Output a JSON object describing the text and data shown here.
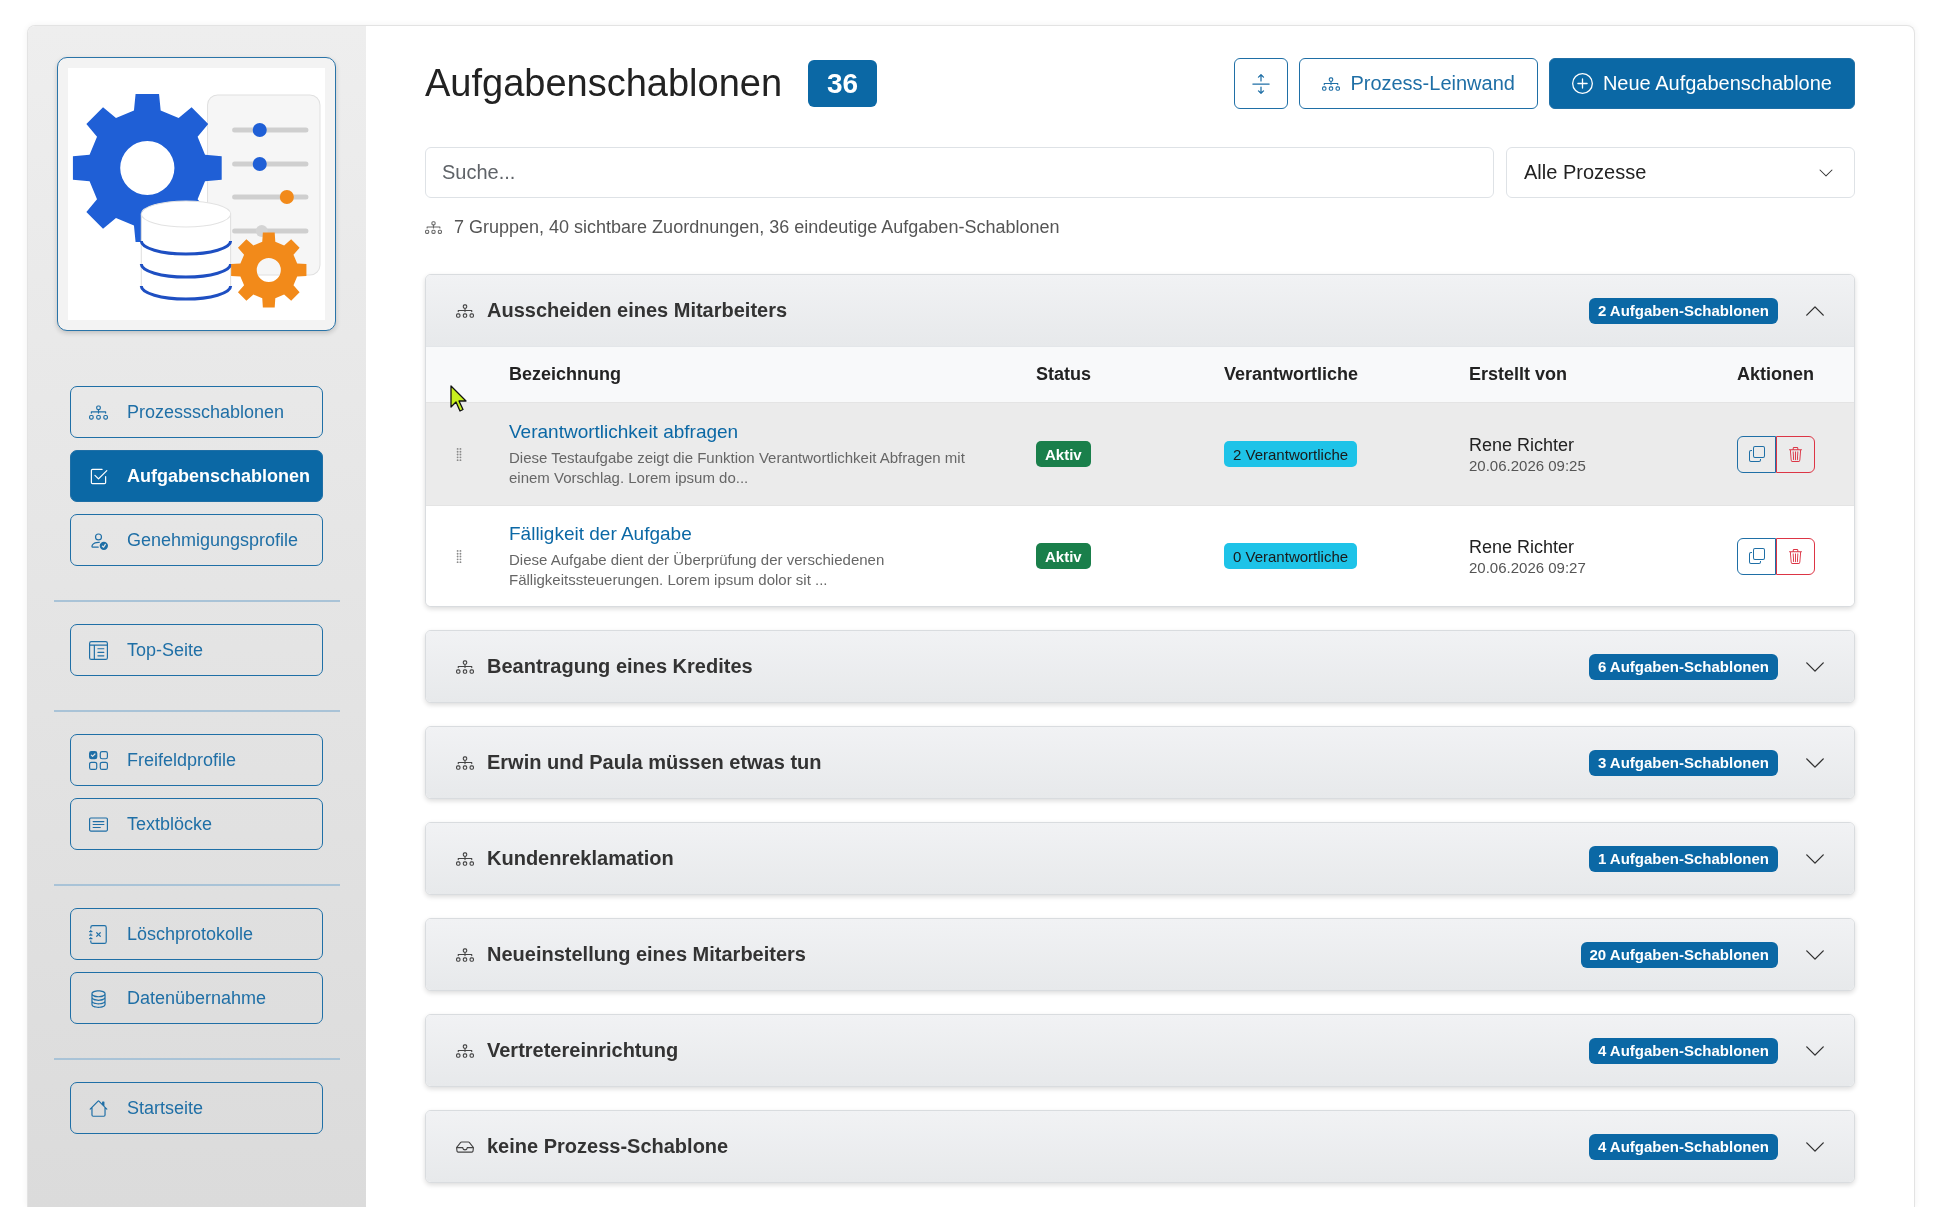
{
  "sidebar": {
    "sections": [
      {
        "items": [
          {
            "kind": "processes",
            "label": "Prozessschablonen",
            "selected": false
          },
          {
            "kind": "tasks",
            "label": "Aufgabenschablonen",
            "selected": true
          },
          {
            "kind": "approvals",
            "label": "Genehmigungsprofile",
            "selected": false
          }
        ]
      },
      {
        "items": [
          {
            "kind": "overview",
            "label": "Top-Seite",
            "selected": false
          }
        ]
      },
      {
        "items": [
          {
            "kind": "fields",
            "label": "Freifeldprofile",
            "selected": false
          },
          {
            "kind": "texts",
            "label": "Textblöcke",
            "selected": false
          }
        ]
      },
      {
        "items": [
          {
            "kind": "deletions",
            "label": "Löschprotokolle",
            "selected": false
          },
          {
            "kind": "import",
            "label": "Datenübernahme",
            "selected": false
          }
        ]
      },
      {
        "items": [
          {
            "kind": "home",
            "label": "Startseite",
            "selected": false
          }
        ]
      }
    ]
  },
  "header": {
    "title": "Aufgabenschablonen",
    "count": "36",
    "actions": [
      {
        "kind": "expand"
      },
      {
        "kind": "canvas",
        "label": "Prozess-Leinwand"
      },
      {
        "kind": "new",
        "label": "Neue Aufgabenschablone"
      }
    ]
  },
  "search": {
    "placeholder": "Suche..."
  },
  "process_filter": {
    "value": "Alle Prozesse"
  },
  "summary": "7 Gruppen, 40 sichtbare Zuordnungen, 36 eindeutige Aufgaben-Schablonen",
  "groups": [
    {
      "kind": "process",
      "title": "Ausscheiden eines Mitarbeiters",
      "count": "2 Aufgaben-Schablonen",
      "expanded": true,
      "columns": [
        "Bezeichnung",
        "Status",
        "Verantwortliche",
        "Erstellt von",
        "Aktionen"
      ],
      "rows": [
        {
          "title": "Verantwortlichkeit abfragen",
          "description": "Diese Testaufgabe zeigt die Funktion Verantwortlichkeit Abfragen mit einem Vorschlag. Lorem ipsum do...",
          "status": "Aktiv",
          "responsible": "2 Verantwortliche",
          "created_by": "Rene Richter",
          "created_at": "20.06.2026 09:25",
          "highlighted": true
        },
        {
          "title": "Fälligkeit der Aufgabe",
          "description": "Diese Aufgabe dient der Überprüfung der verschiedenen Fälligkeitssteuerungen. Lorem ipsum dolor sit ...",
          "status": "Aktiv",
          "responsible": "0 Verantwortliche",
          "created_by": "Rene Richter",
          "created_at": "20.06.2026 09:27",
          "highlighted": false
        }
      ]
    },
    {
      "kind": "process",
      "title": "Beantragung eines Kredites",
      "count": "6 Aufgaben-Schablonen",
      "expanded": false
    },
    {
      "kind": "process",
      "title": "Erwin und Paula müssen etwas tun",
      "count": "3 Aufgaben-Schablonen",
      "expanded": false
    },
    {
      "kind": "process",
      "title": "Kundenreklamation",
      "count": "1 Aufgaben-Schablonen",
      "expanded": false
    },
    {
      "kind": "process",
      "title": "Neueinstellung eines Mitarbeiters",
      "count": "20 Aufgaben-Schablonen",
      "expanded": false
    },
    {
      "kind": "process",
      "title": "Vertretereinrichtung",
      "count": "4 Aufgaben-Schablonen",
      "expanded": false
    },
    {
      "kind": "none",
      "title": "keine Prozess-Schablone",
      "count": "4 Aufgaben-Schablonen",
      "expanded": false
    }
  ]
}
